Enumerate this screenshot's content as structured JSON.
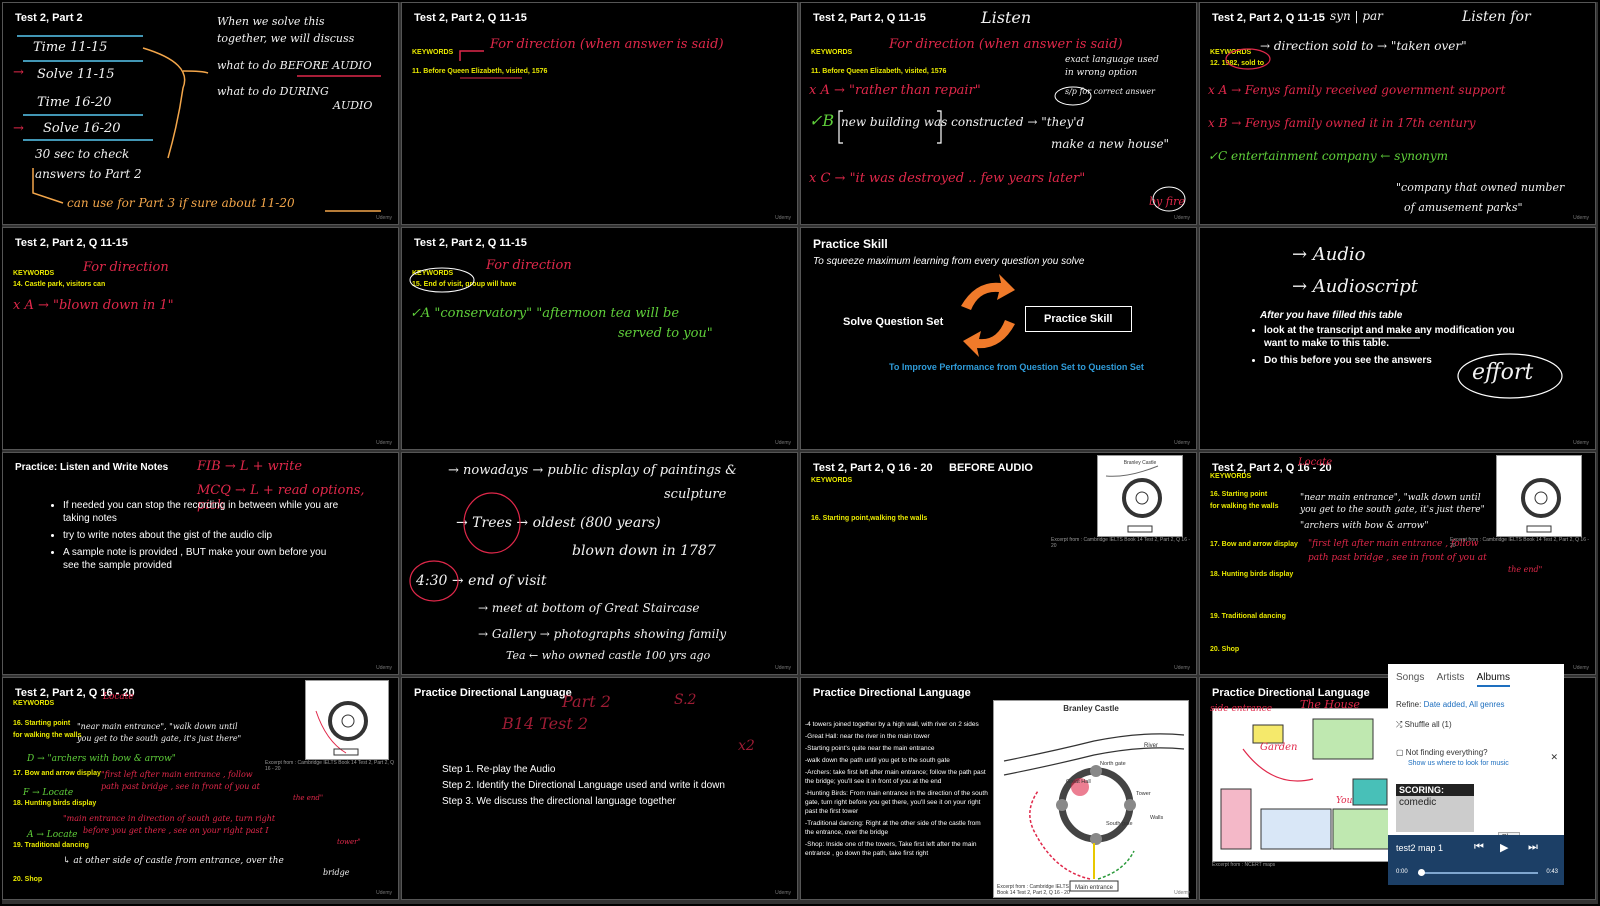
{
  "slides": {
    "s1": {
      "title": "Test 2, Part 2",
      "notes": [
        "Time 11-15",
        "Solve 11-15",
        "Time 16-20",
        "Solve 16-20",
        "30 sec to check",
        "answers to Part 2",
        "can use for Part 3 if sure about 11-20"
      ],
      "right": [
        "When we solve this",
        "together, we will discuss",
        "what to do BEFORE AUDIO",
        "what to do DURING",
        "AUDIO"
      ]
    },
    "s2": {
      "title": "Test 2, Part 2, Q 11-15",
      "keywords": "KEYWORDS",
      "q": "11. Before Queen Elizabeth, visited, 1576",
      "hw": "For direction (when answer is said)"
    },
    "s3": {
      "title": "Test 2, Part 2, Q 11-15",
      "keywords": "KEYWORDS",
      "q": "11. Before Queen Elizabeth, visited, 1576",
      "hw": [
        "Listen",
        "For direction (when answer is said)",
        "exact language used",
        "in wrong option",
        "s/p for correct answer",
        "x A → \"rather than repair\"",
        "new building was constructed → \"they'd",
        "make a new house\"",
        "x C → \"it was destroyed .. few years later\"",
        "by fire"
      ]
    },
    "s4": {
      "title": "Test 2, Part 2, Q 11-15",
      "keywords": "KEYWORDS",
      "q": "12. 1982, sold to",
      "hw": [
        "syn | par",
        "Listen for",
        "→ direction  sold to → \"taken over\"",
        "x A → Fenys family received government support",
        "x B → Fenys family owned it in 17th century",
        "✓C   entertainment company ← synonym",
        "\"company that owned number",
        "of amusement parks\""
      ]
    },
    "s5": {
      "title": "Test 2, Part 2, Q 11-15",
      "keywords": "KEYWORDS",
      "q": "14. Castle park, visitors can",
      "hw": [
        "For direction",
        "x A → \"blown down in 1\""
      ]
    },
    "s6": {
      "title": "Test 2, Part 2, Q 11-15",
      "keywords": "KEYWORDS",
      "q": "15. End of visit, group will have",
      "hw": [
        "For direction",
        "✓A   \"conservatory\"   \"afternoon tea will be",
        "served to you\""
      ]
    },
    "s7": {
      "title": "Practice Skill",
      "subtitle": "To squeeze maximum learning from every question you solve",
      "left": "Solve Question Set",
      "right": "Practice Skill",
      "bottom": "To Improve Performance from Question Set to Question Set"
    },
    "s8": {
      "hw": [
        "→ Audio",
        "→ Audioscript",
        "effort"
      ],
      "heading": "After you have filled this table",
      "bullets": [
        "look at the transcript and make any modification you want to make to this table.",
        "Do this before you see the answers"
      ]
    },
    "s9": {
      "title": "Practice: Listen and Write Notes",
      "hw": [
        "FIB → L + write",
        "MCQ → L + read options, pick"
      ],
      "bullets": [
        "If needed you can stop the recording in between while you are taking notes",
        "try to write notes about the gist of the audio clip",
        "A sample note is provided , BUT make your own before you see the sample provided"
      ]
    },
    "s10": {
      "hw": [
        "→ nowadays → public display of paintings &",
        "sculpture",
        "→ Trees → oldest (800 years)",
        "blown down in 1787",
        "4:30 → end of visit",
        "→ meet at bottom of Great Staircase",
        "→ Gallery → photographs showing family",
        "Tea   ← who owned castle 100 yrs ago"
      ]
    },
    "s11": {
      "title": "Test 2, Part 2, Q 16 - 20",
      "banner": "BEFORE AUDIO",
      "keywords": "KEYWORDS",
      "q": "16. Starting point,walking the walls",
      "caption": "Excerpt from : Cambridge IELTS Book 14 Test 2, Part 2, Q 16 - 20",
      "map_title": "Branley Castle"
    },
    "s12": {
      "title": "Test 2, Part 2, Q 16 - 20",
      "keywords": "KEYWORDS",
      "qs": [
        "16. Starting point",
        "for walking the walls",
        "17. Bow and arrow display",
        "18. Hunting birds display",
        "19. Traditional dancing",
        "20. Shop"
      ],
      "hw": [
        "Locate",
        "\"near main entrance\", \"walk down until",
        "you get to the south gate, it's just there\"",
        "\"archers with bow & arrow\"",
        "\"first left after main entrance , follow",
        "path past bridge , see in front of you at",
        "the end\""
      ],
      "caption": "Excerpt from : Cambridge IELTS Book 14 Test 2, Part 2, Q 16 - 20"
    },
    "s13": {
      "title": "Test 2, Part 2, Q 16 - 20",
      "keywords": "KEYWORDS",
      "qs": [
        "16. Starting point",
        "for walking the walls",
        "17. Bow and arrow display",
        "18. Hunting birds display",
        "19. Traditional dancing",
        "20. Shop"
      ],
      "hw": [
        "Locate",
        "\"near main entrance\", \"walk down until",
        "you get to the south gate, it's just there\"",
        "D → \"archers with bow & arrow\"",
        "\"first left after main entrance , follow",
        "path past bridge , see in front of you at",
        "the end\"",
        "F → Locate",
        "\"main entrance in direction of south gate, turn right",
        "before you get there , see on your right past I",
        "tower\"",
        "A → Locate",
        "↳ at other side of castle from entrance, over the",
        "bridge"
      ],
      "caption": "Excerpt from : Cambridge IELTS Book 14 Test 2, Part 2, Q 16 - 20"
    },
    "s14": {
      "title": "Practice Directional Language",
      "hw": [
        "B14 Test 2",
        "Part 2",
        "S.2",
        "x2"
      ],
      "steps": [
        "Step 1. Re-play the Audio",
        "Step 2. Identify the Directional Language used and write it down",
        "Step 3. We discuss the directional language together"
      ]
    },
    "s15": {
      "title": "Practice Directional Language",
      "lines": [
        "-4 towers joined together by a high wall, with river on 2 sides",
        "-Great Hall: near the river in the main tower",
        "-Starting point's quite near the main entrance",
        "-walk down the path until you get to the south gate",
        "-Archers: take first left after main entrance; follow the path past the bridge; you'll see it in front of you at the end",
        "-Hunting Birds: From main entrance in the direction of the south gate, turn right before you get there, you'll see it on your right past the first tower",
        "-Traditional dancing: Right at the other side of the castle from the entrance, over the bridge",
        "-Shop: Inside one of the towers, Take first left after the main entrance , go down the path, take first right"
      ],
      "map_title": "Branley Castle",
      "map_labels": [
        "River",
        "North gate",
        "Great Hall",
        "Tower",
        "Walls",
        "South gate",
        "Main entrance"
      ],
      "caption1": "Excerpt from : Cambridge IELTS",
      "caption2": "Book 14 Test 2, Part 2, Q 16 - 20"
    },
    "s16": {
      "title": "Practice Directional Language",
      "hw": [
        "side entrance",
        "The House",
        "Garden",
        "You"
      ],
      "caption": "Excerpt from : NCERT maps"
    }
  },
  "player": {
    "tabs": [
      "Songs",
      "Artists",
      "Albums"
    ],
    "refine_label": "Refine:",
    "refine_value": "Date added, All genres",
    "shuffle": "Shuffle all (1)",
    "not_finding": "Not finding everything?",
    "show_where": "Show us where to look for music",
    "album_title": "SCORING:",
    "album_sub": "comedic",
    "track": "test2 map 1",
    "time_start": "0:00",
    "time_end": "0:43",
    "tooltip": "Play"
  }
}
